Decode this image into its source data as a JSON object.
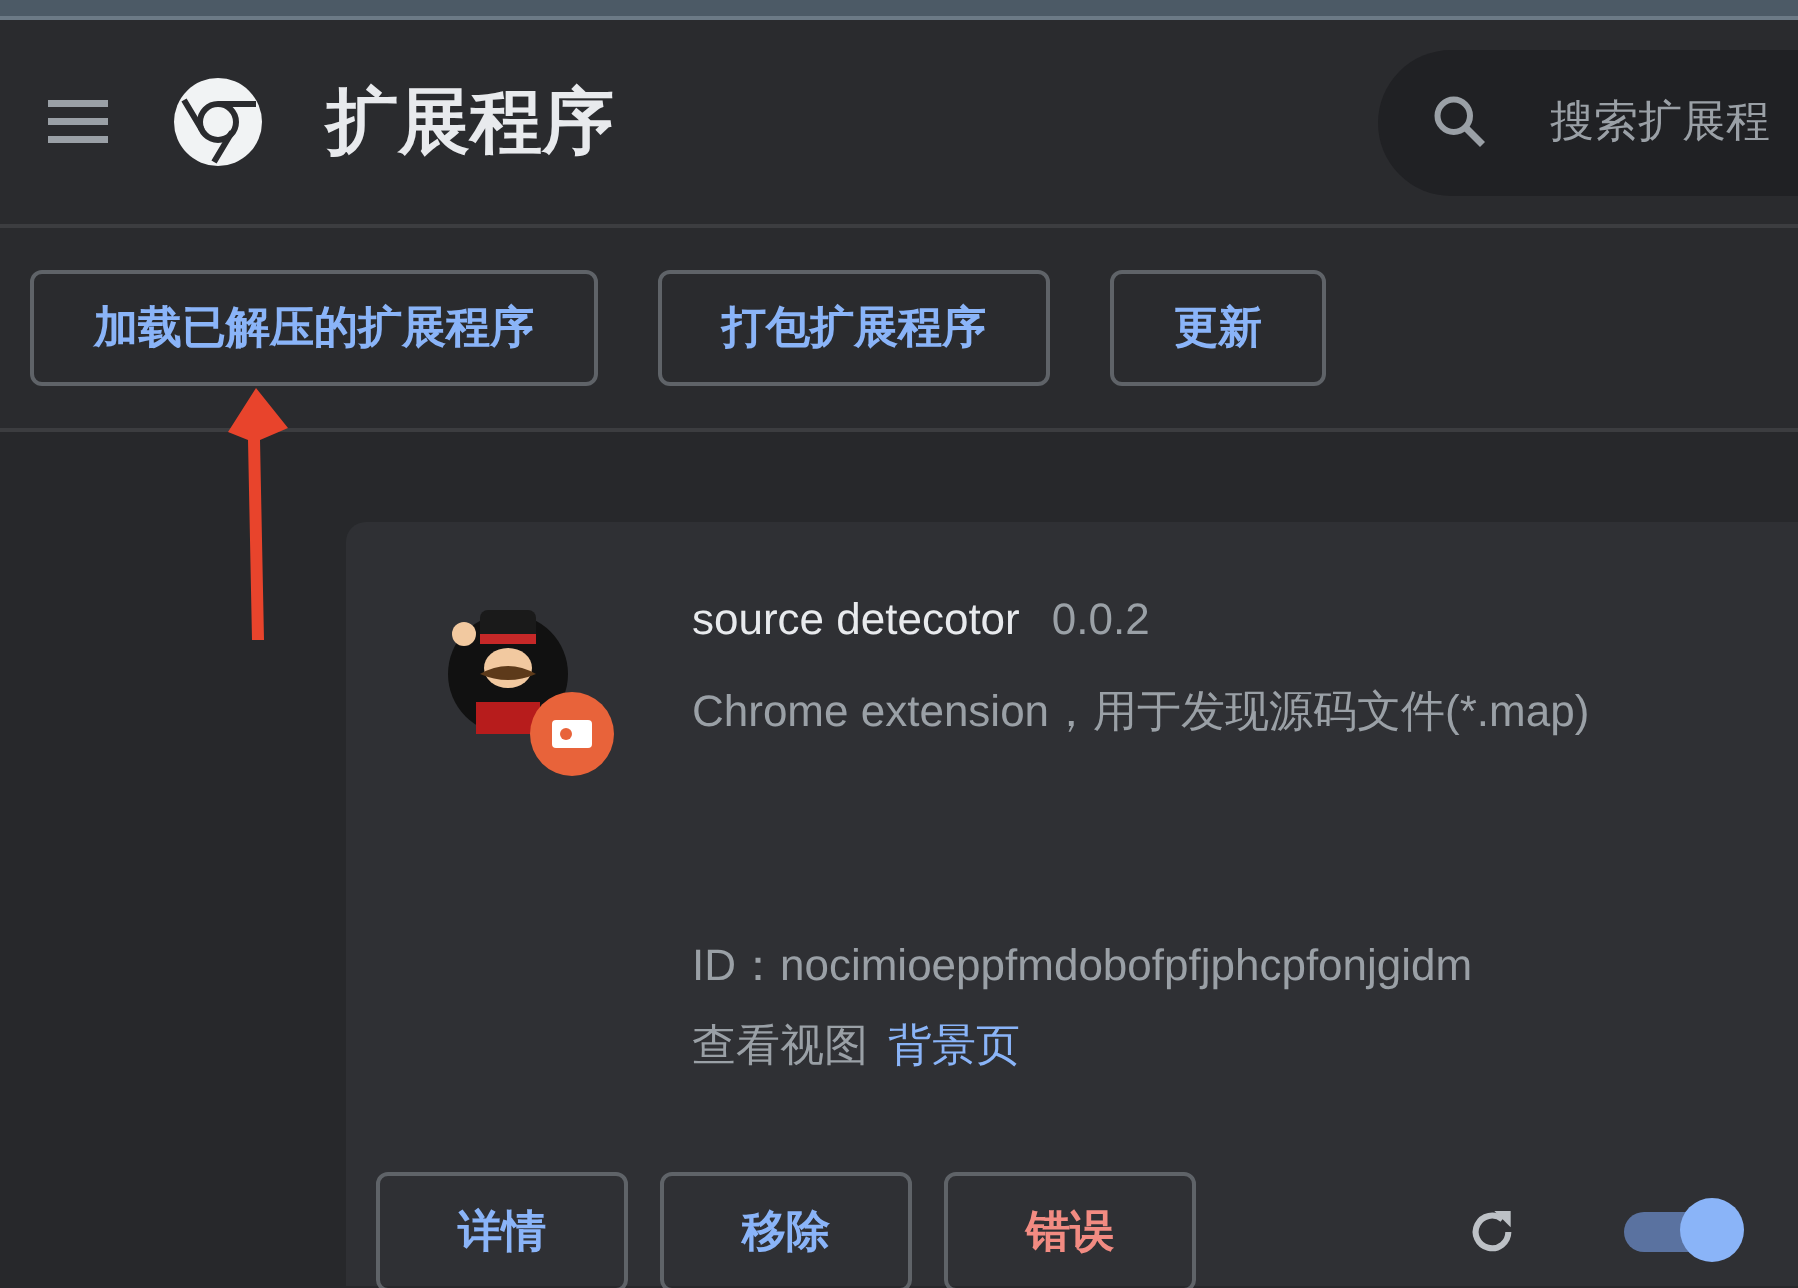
{
  "header": {
    "title": "扩展程序",
    "search": {
      "placeholder": "搜索扩展程"
    }
  },
  "toolbar": {
    "buttons": [
      {
        "label": "加载已解压的扩展程序"
      },
      {
        "label": "打包扩展程序"
      },
      {
        "label": "更新"
      }
    ]
  },
  "extension": {
    "name": "source detecotor",
    "version": "0.0.2",
    "description": "Chrome extension，用于发现源码文件(*.map)",
    "id": "ID：nocimioeppfmdobofpfjphcpfonjgidm",
    "views_label": "查看视图",
    "views_link": "背景页",
    "enabled": true,
    "buttons": [
      {
        "label": "详情",
        "kind": "normal"
      },
      {
        "label": "移除",
        "kind": "normal"
      },
      {
        "label": "错误",
        "kind": "error"
      }
    ]
  }
}
